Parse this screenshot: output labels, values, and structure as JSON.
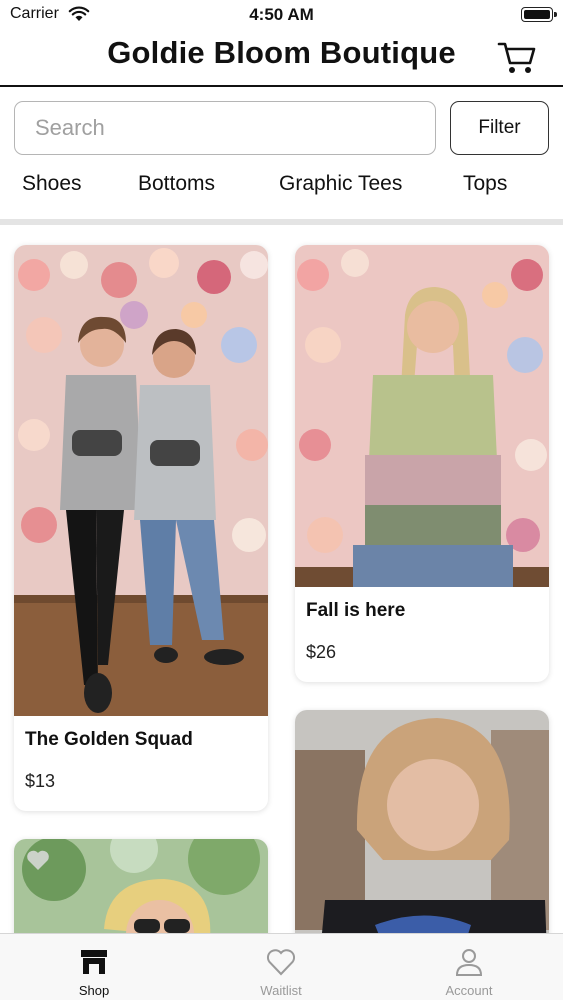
{
  "status_bar": {
    "carrier": "Carrier",
    "time": "4:50 AM"
  },
  "header": {
    "title": "Goldie Bloom Boutique",
    "cart_icon": "cart-icon"
  },
  "search": {
    "placeholder": "Search",
    "value": ""
  },
  "filter": {
    "label": "Filter"
  },
  "categories": [
    "Shoes",
    "Bottoms",
    "Graphic Tees",
    "Tops"
  ],
  "products": [
    {
      "name": "The Golden Squad",
      "price": "$13"
    },
    {
      "name": "Fall is here",
      "price": "$26"
    },
    {
      "name": "",
      "price": ""
    },
    {
      "name": "",
      "price": ""
    }
  ],
  "tabs": [
    {
      "label": "Shop",
      "icon": "store-icon",
      "active": true
    },
    {
      "label": "Waitlist",
      "icon": "heart-icon",
      "active": false
    },
    {
      "label": "Account",
      "icon": "person-icon",
      "active": false
    }
  ],
  "colors": {
    "active_tab": "#111111",
    "inactive_tab": "#9a9a9a",
    "divider": "#e4e4e4"
  }
}
